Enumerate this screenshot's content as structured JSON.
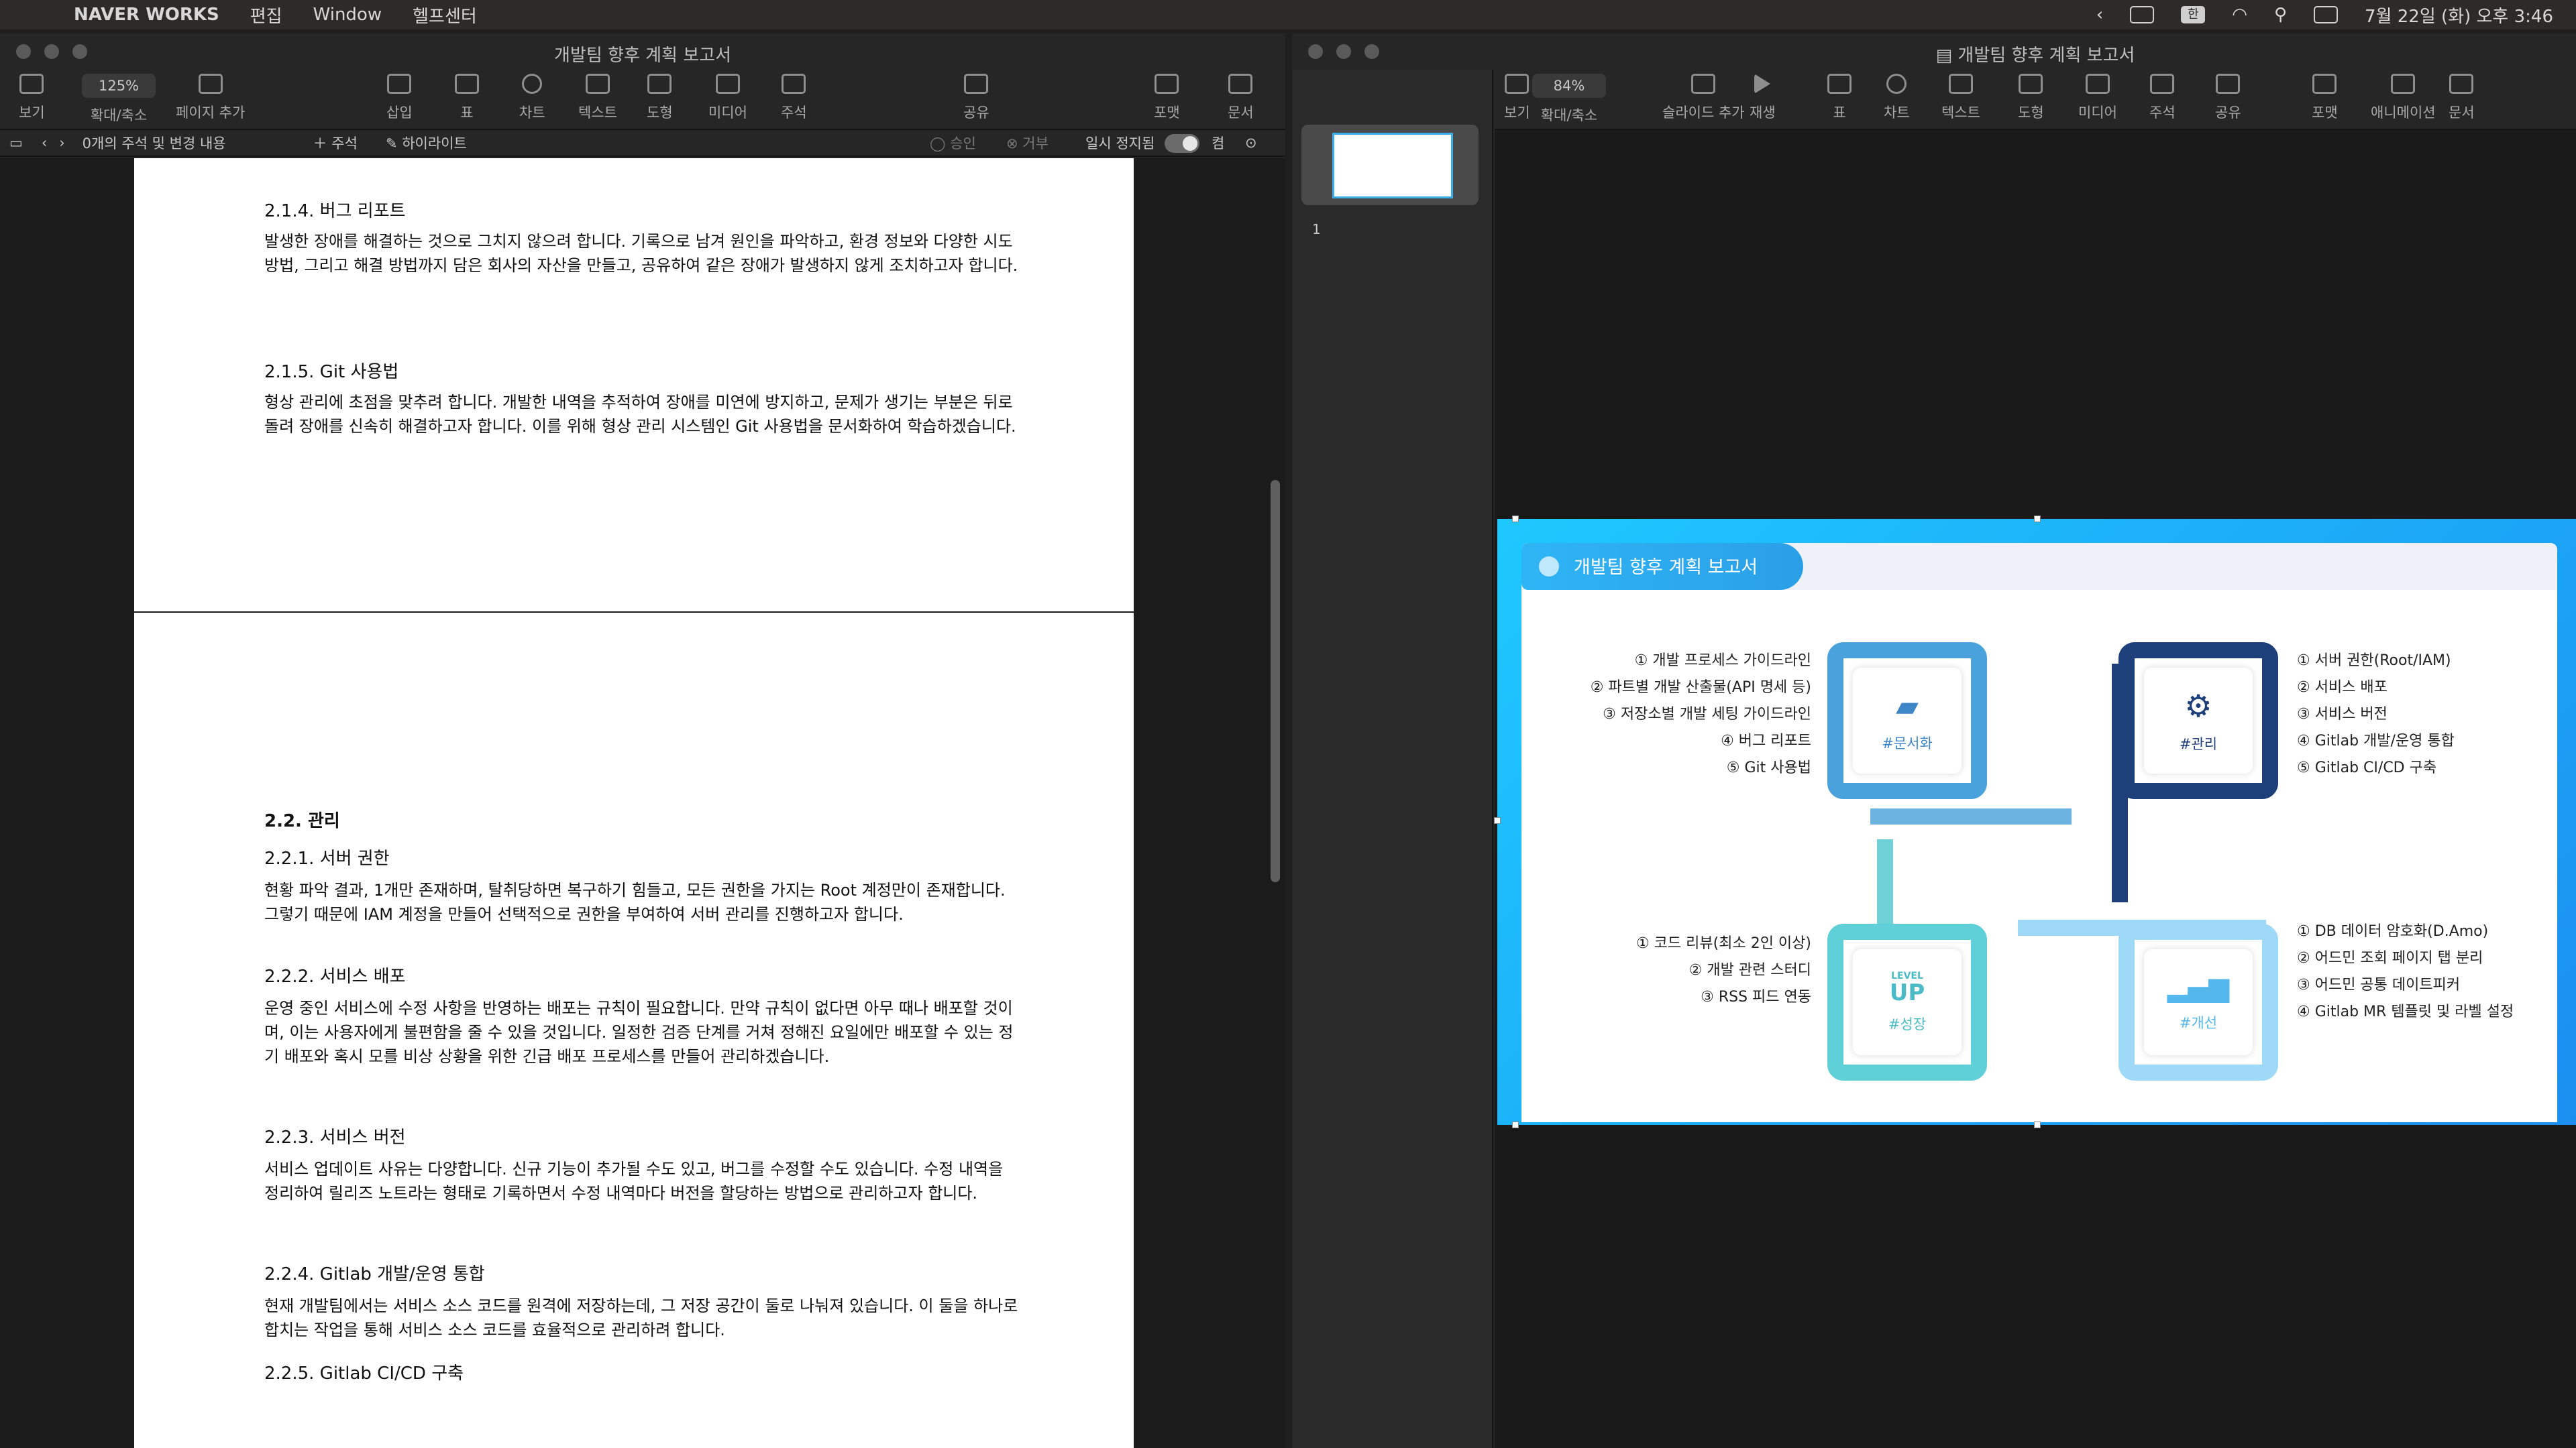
{
  "menubar": {
    "app_name": "NAVER WORKS",
    "menus": [
      "편집",
      "Window",
      "헬프센터"
    ],
    "datetime": "7월 22일 (화) 오후 3:46",
    "input_source": "한"
  },
  "left_window": {
    "title": "개발팀 향후 계획 보고서",
    "toolbar": {
      "view": "보기",
      "zoom_value": "125%",
      "zoom_label": "확대/축소",
      "add_page": "페이지 추가",
      "insert": "삽입",
      "table": "표",
      "chart": "차트",
      "text": "텍스트",
      "shape": "도형",
      "media": "미디어",
      "comment": "주석",
      "share": "공유",
      "format": "포맷",
      "document": "문서"
    },
    "subbar": {
      "comments_count": "0개의 주석 및 변경 내용",
      "add_comment": "주석",
      "highlight": "하이라이트",
      "approve": "승인",
      "reject": "거부",
      "pause": "일시 정지됨",
      "on": "켬"
    },
    "page1": {
      "h_bug": "2.1.4. 버그 리포트",
      "p_bug": "발생한 장애를 해결하는 것으로 그치지 않으려 합니다. 기록으로 남겨 원인을 파악하고, 환경 정보와 다양한 시도 방법, 그리고 해결 방법까지 담은 회사의 자산을 만들고, 공유하여 같은 장애가 발생하지 않게 조치하고자 합니다.",
      "h_git": "2.1.5. Git 사용법",
      "p_git": "형상 관리에 초점을 맞추려 합니다. 개발한 내역을 추적하여 장애를 미연에 방지하고, 문제가 생기는 부분은 뒤로 돌려 장애를 신속히 해결하고자 합니다. 이를 위해 형상 관리 시스템인 Git 사용법을 문서화하여 학습하겠습니다."
    },
    "page2": {
      "h_manage": "2.2. 관리",
      "h_server": "2.2.1. 서버 권한",
      "p_server": "현황 파악 결과, 1개만 존재하며, 탈취당하면 복구하기 힘들고, 모든 권한을 가지는 Root 계정만이 존재합니다. 그렇기 때문에 IAM 계정을 만들어 선택적으로 권한을 부여하여 서버 관리를 진행하고자 합니다.",
      "h_deploy": "2.2.2. 서비스 배포",
      "p_deploy": "운영 중인 서비스에 수정 사항을 반영하는 배포는 규칙이 필요합니다. 만약 규칙이 없다면 아무 때나 배포할 것이며, 이는 사용자에게 불편함을 줄 수 있을 것입니다. 일정한 검증 단계를 거쳐 정해진 요일에만 배포할 수 있는 정기 배포와 혹시 모를 비상 상황을 위한 긴급 배포 프로세스를 만들어 관리하겠습니다.",
      "h_version": "2.2.3. 서비스 버전",
      "p_version": "서비스 업데이트 사유는 다양합니다. 신규 기능이 추가될 수도 있고, 버그를 수정할 수도 있습니다. 수정 내역을 정리하여 릴리즈 노트라는 형태로 기록하면서 수정 내역마다 버전을 할당하는 방법으로 관리하고자 합니다.",
      "h_gitlab": "2.2.4. Gitlab 개발/운영 통합",
      "p_gitlab": "현재 개발팀에서는 서비스 소스 코드를 원격에 저장하는데, 그 저장 공간이 둘로 나눠져 있습니다. 이 둘을 하나로 합치는 작업을 통해 서비스 소스 코드를 효율적으로 관리하려 합니다.",
      "h_cicd": "2.2.5. Gitlab CI/CD 구축"
    }
  },
  "right_window": {
    "title": "개발팀 향후 계획 보고서",
    "toolbar": {
      "view": "보기",
      "zoom_value": "84%",
      "zoom_label": "확대/축소",
      "add_slide": "슬라이드 추가",
      "play": "재생",
      "table": "표",
      "chart": "차트",
      "text": "텍스트",
      "shape": "도형",
      "media": "미디어",
      "comment": "주석",
      "share": "공유",
      "format": "포맷",
      "animate": "애니메이션",
      "document": "문서"
    },
    "slide_number": "1",
    "slide": {
      "title": "개발팀 향후 계획 보고서",
      "docs": {
        "tag": "#문서화",
        "items": [
          "① 개발 프로세스 가이드라인",
          "② 파트별 개발 산출물(API 명세 등)",
          "③ 저장소별 개발 세팅 가이드라인",
          "④ 버그 리포트",
          "⑤ Git 사용법"
        ]
      },
      "manage": {
        "tag": "#관리",
        "items": [
          "① 서버 권한(Root/IAM)",
          "② 서비스 배포",
          "③ 서비스 버전",
          "④ Gitlab 개발/운영 통합",
          "⑤ Gitlab CI/CD 구축"
        ]
      },
      "growth": {
        "tag": "#성장",
        "badge_top": "LEVEL",
        "badge_main": "UP",
        "items": [
          "① 코드 리뷰(최소 2인 이상)",
          "② 개발 관련 스터디",
          "③ RSS 피드 연동"
        ]
      },
      "improve": {
        "tag": "#개선",
        "items": [
          "① DB 데이터 암호화(D.Amo)",
          "② 어드민 조회 페이지 탭 분리",
          "③ 어드민 공통 데이트피커",
          "④ Gitlab MR 템플릿 및 라벨 설정"
        ]
      },
      "colors": {
        "docs": "#4aa2dc",
        "manage": "#1d3f7a",
        "growth": "#5fcfd8",
        "improve": "#9ed9f7"
      }
    }
  }
}
